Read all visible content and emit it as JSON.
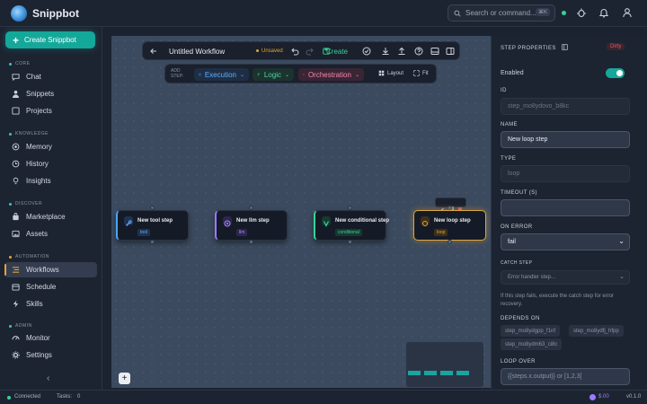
{
  "app": {
    "name": "Snippbot"
  },
  "search": {
    "placeholder": "Search or command...",
    "shortcut": "⌘K"
  },
  "sidebar": {
    "create_label": "Create Snippbot",
    "sections": [
      {
        "label": "CORE",
        "items": [
          "Chat",
          "Snippets",
          "Projects"
        ]
      },
      {
        "label": "KNOWLEDGE",
        "items": [
          "Memory",
          "History",
          "Insights"
        ]
      },
      {
        "label": "DISCOVER",
        "items": [
          "Marketplace",
          "Assets"
        ]
      },
      {
        "label": "AUTOMATION",
        "items": [
          "Workflows",
          "Schedule",
          "Skills"
        ]
      },
      {
        "label": "ADMIN",
        "items": [
          "Monitor",
          "Settings"
        ]
      }
    ],
    "active": "Workflows",
    "collapse_icon": "‹"
  },
  "toolbar": {
    "title": "Untitled Workflow",
    "unsaved": "Unsaved",
    "create": "Create"
  },
  "addbar": {
    "label_1": "ADD",
    "label_2": "STEP:",
    "execution": "Execution",
    "logic": "Logic",
    "orchestration": "Orchestration",
    "layout": "Layout",
    "fit": "Fit"
  },
  "nodes": [
    {
      "title": "New tool step",
      "tag": "tool",
      "color": "#4da3ff"
    },
    {
      "title": "New llm step",
      "tag": "llm",
      "color": "#9b7bff"
    },
    {
      "title": "New conditional step",
      "tag": "conditional",
      "color": "#36d399"
    },
    {
      "title": "New loop step",
      "tag": "loop",
      "color": "#e0a53a"
    }
  ],
  "panel": {
    "title": "STEP PROPERTIES",
    "dirty": "Dirty",
    "enabled_label": "Enabled",
    "enabled": true,
    "id_label": "ID",
    "id_value": "step_mo8ydovo_b8kc",
    "name_label": "NAME",
    "name_value": "New loop step",
    "type_label": "TYPE",
    "type_value": "loop",
    "timeout_label": "TIMEOUT (S)",
    "timeout_value": "",
    "on_error_label": "ON ERROR",
    "on_error_value": "fail",
    "catch_label": "CATCH STEP",
    "catch_placeholder": "Error handler step...",
    "catch_help": "If this step fails, execute the catch step for error recovery.",
    "depends_label": "DEPENDS ON",
    "depends": [
      "step_mo8ydgpp_f1nf",
      "step_mo8ydfj_hfpp",
      "step_mo8ydm63_ci8c"
    ],
    "loop_label": "LOOP OVER",
    "loop_placeholder": "{{steps.x.output}} or [1,2,3]"
  },
  "status": {
    "connected": "Connected",
    "tasks_label": "Tasks:",
    "tasks_value": "0",
    "cost": "$.00",
    "version": "v0.1.0"
  },
  "colors": {
    "accent": "#14a89a",
    "warning": "#e0a53a",
    "danger": "#e35b5b",
    "success": "#36d399"
  }
}
